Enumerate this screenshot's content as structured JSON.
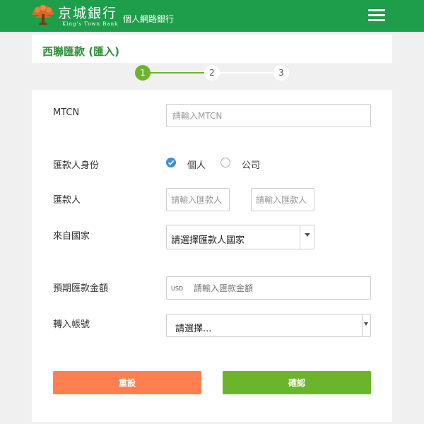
{
  "header": {
    "bank_name_cn": "京城銀行",
    "bank_name_en": "King's Town Bank",
    "subtitle": "個人網路銀行"
  },
  "page": {
    "title": "西聯匯款 (匯入)"
  },
  "steps": [
    {
      "label": "1",
      "state": "active"
    },
    {
      "label": "2",
      "state": "pending"
    },
    {
      "label": "3",
      "state": "pending"
    }
  ],
  "form": {
    "mtcn": {
      "label": "MTCN",
      "placeholder": "請輸入MTCN",
      "value": ""
    },
    "remitter_identity": {
      "label": "匯款人身份",
      "options": [
        {
          "label": "個人",
          "selected": true
        },
        {
          "label": "公司",
          "selected": false
        }
      ]
    },
    "remitter": {
      "label": "匯款人",
      "placeholder_1": "請輸入匯款人",
      "placeholder_2": "請輸入匯款人"
    },
    "country": {
      "label": "來自國家",
      "selected": "請選擇匯款人國家"
    },
    "amount": {
      "label": "預期匯款金額",
      "currency": "USD",
      "placeholder": "請輸入匯款金額"
    },
    "account": {
      "label": "轉入帳號",
      "selected": "請選擇..."
    }
  },
  "buttons": {
    "reset": "重設",
    "confirm": "確認"
  },
  "colors": {
    "header_bg": "#1e9e4a",
    "title_text": "#2a8f35",
    "step_active": "#6bb52c",
    "reset_button": "#ff7f50",
    "confirm_button": "#6bb52c",
    "radio_checked": "#3b8fd6"
  },
  "icons": {
    "logo": "tree-logo-icon",
    "menu": "hamburger-menu-icon",
    "radio_checked": "check-circle-icon",
    "dropdown": "caret-down-icon"
  }
}
